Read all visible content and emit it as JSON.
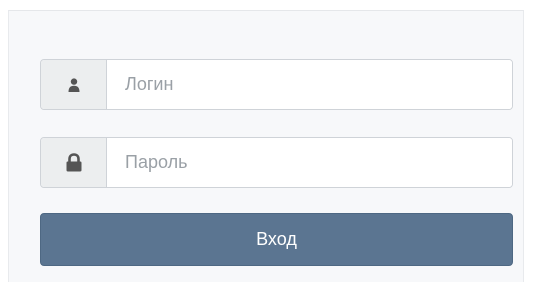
{
  "login_form": {
    "username": {
      "icon": "user-icon",
      "placeholder": "Логин",
      "value": ""
    },
    "password": {
      "icon": "lock-icon",
      "placeholder": "Пароль",
      "value": ""
    },
    "submit_label": "Вход"
  },
  "colors": {
    "button_bg": "#5b7591",
    "button_text": "#ffffff",
    "addon_bg": "#eceeef",
    "icon": "#555555",
    "border": "#cfd3d8",
    "placeholder": "#9aa0a6"
  }
}
